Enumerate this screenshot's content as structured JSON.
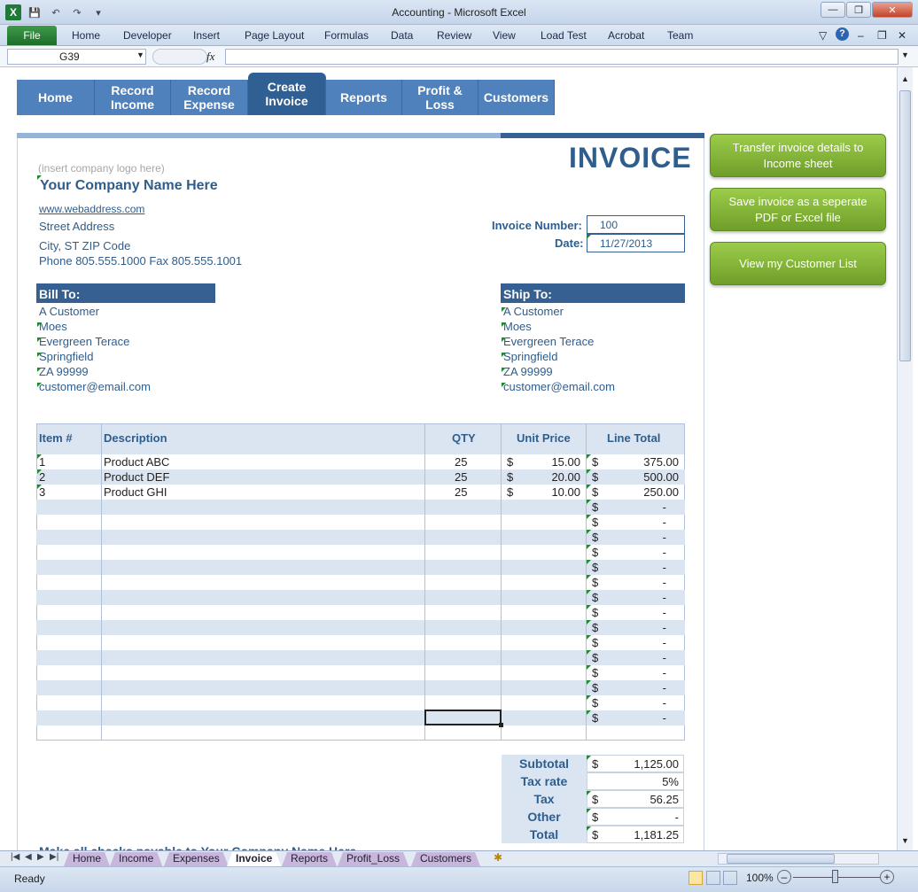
{
  "window": {
    "title": "Accounting  -  Microsoft Excel"
  },
  "ribbon": {
    "file": "File",
    "tabs": [
      "Home",
      "Developer",
      "Insert",
      "Page Layout",
      "Formulas",
      "Data",
      "Review",
      "View",
      "Load Test",
      "Acrobat",
      "Team"
    ]
  },
  "formula_bar": {
    "cell_ref": "G39",
    "fx": "fx",
    "value": ""
  },
  "nav": [
    {
      "label": "Home"
    },
    {
      "label": "Record\nIncome"
    },
    {
      "label": "Record\nExpense"
    },
    {
      "label": "Create\nInvoice"
    },
    {
      "label": "Reports"
    },
    {
      "label": "Profit &\nLoss"
    },
    {
      "label": "Customers"
    }
  ],
  "actions": {
    "transfer": "Transfer invoice details to Income  sheet",
    "save": "Save invoice as a seperate PDF or Excel file",
    "view_customers": "View my Customer List"
  },
  "invoice": {
    "heading": "INVOICE",
    "logo_placeholder": "(insert company logo here)",
    "company_name": "Your Company Name Here",
    "web": "www.webaddress.com",
    "street": "Street Address",
    "city": "City, ST  ZIP Code",
    "phone": "Phone 805.555.1000    Fax 805.555.1001",
    "number_label": "Invoice Number:",
    "number": "100",
    "date_label": "Date:",
    "date": "11/27/2013",
    "bill_to_label": "Bill To:",
    "ship_to_label": "Ship To:",
    "bill_to": [
      "A Customer",
      "Moes",
      "Evergreen Terace",
      "Springfield",
      "ZA 99999",
      "customer@email.com"
    ],
    "ship_to": [
      "A Customer",
      "Moes",
      "Evergreen Terace",
      "Springfield",
      "ZA 99999",
      "customer@email.com"
    ],
    "columns": {
      "item": "Item #",
      "desc": "Description",
      "qty": "QTY",
      "unit": "Unit Price",
      "total": "Line Total"
    },
    "items": [
      {
        "item": "1",
        "desc": "Product ABC",
        "qty": "25",
        "unit_cur": "$",
        "unit": "15.00",
        "total_cur": "$",
        "total": "375.00"
      },
      {
        "item": "2",
        "desc": "Product DEF",
        "qty": "25",
        "unit_cur": "$",
        "unit": "20.00",
        "total_cur": "$",
        "total": "500.00"
      },
      {
        "item": "3",
        "desc": "Product GHI",
        "qty": "25",
        "unit_cur": "$",
        "unit": "10.00",
        "total_cur": "$",
        "total": "250.00"
      }
    ],
    "empty_total": {
      "cur": "$",
      "value": "-"
    },
    "empty_rows": 15,
    "totals": [
      {
        "label": "Subtotal",
        "cur": "$",
        "value": "1,125.00"
      },
      {
        "label": "Tax rate",
        "cur": "",
        "value": "5%"
      },
      {
        "label": "Tax",
        "cur": "$",
        "value": "56.25"
      },
      {
        "label": "Other",
        "cur": "$",
        "value": "-"
      },
      {
        "label": "Total",
        "cur": "$",
        "value": "1,181.25"
      }
    ],
    "footer_note": "Make all checks payable to Your Company Name Here"
  },
  "sheet_tabs": [
    "Home",
    "Income",
    "Expenses",
    "Invoice",
    "Reports",
    "Profit_Loss",
    "Customers"
  ],
  "active_sheet": "Invoice",
  "status": {
    "ready": "Ready",
    "zoom": "100%"
  }
}
